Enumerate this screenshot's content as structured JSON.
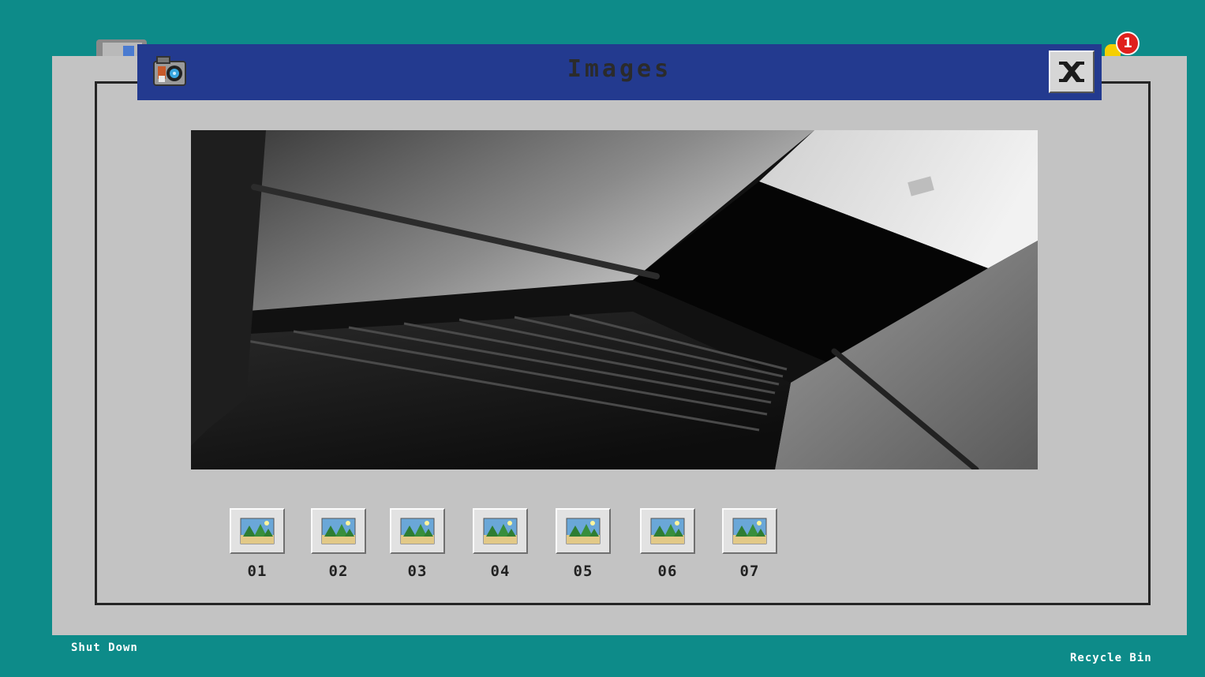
{
  "window": {
    "title": "Images",
    "title_icon": "camera-icon",
    "close_icon": "close-icon"
  },
  "viewer": {
    "image": "stairwell-photo",
    "description_icon": "grayscale-staircase"
  },
  "thumbnails": [
    {
      "label": "01",
      "icon": "picture-icon"
    },
    {
      "label": "02",
      "icon": "picture-icon"
    },
    {
      "label": "03",
      "icon": "picture-icon"
    },
    {
      "label": "04",
      "icon": "picture-icon"
    },
    {
      "label": "05",
      "icon": "picture-icon"
    },
    {
      "label": "06",
      "icon": "picture-icon"
    },
    {
      "label": "07",
      "icon": "picture-icon"
    }
  ],
  "desktop": {
    "shutdown_label": "Shut Down",
    "recycle_label": "Recycle Bin",
    "notification_count": "1"
  },
  "colors": {
    "desktop": "#0d8b89",
    "titlebar": "#233a8f",
    "panel": "#c3c3c3"
  }
}
